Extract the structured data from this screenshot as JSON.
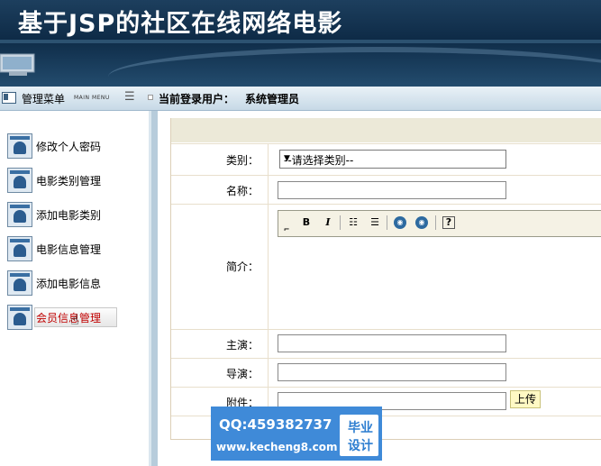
{
  "header": {
    "title": "基于JSP的社区在线网络电影"
  },
  "navbar": {
    "menu_title": "管理菜单",
    "menu_subtitle": "MAIN MENU",
    "user_label": "当前登录用户：",
    "user_name": "系统管理员"
  },
  "sidebar": {
    "items": [
      {
        "label": "修改个人密码"
      },
      {
        "label": "电影类别管理"
      },
      {
        "label": "添加电影类别"
      },
      {
        "label": "电影信息管理"
      },
      {
        "label": "添加电影信息"
      },
      {
        "label": "会员信息管理"
      }
    ]
  },
  "form": {
    "category_label": "类别：",
    "category_value": "--请选择类别--",
    "name_label": "名称：",
    "intro_label": "简介：",
    "actor_label": "主演：",
    "director_label": "导演：",
    "attachment_label": "附件：",
    "upload_button": "上传"
  },
  "editor": {
    "tools": [
      "B",
      "I"
    ]
  },
  "watermark": {
    "qq": "QQ:459382737",
    "url": "www.kecheng8.com",
    "badge_line1": "毕业",
    "badge_line2": "设计"
  }
}
